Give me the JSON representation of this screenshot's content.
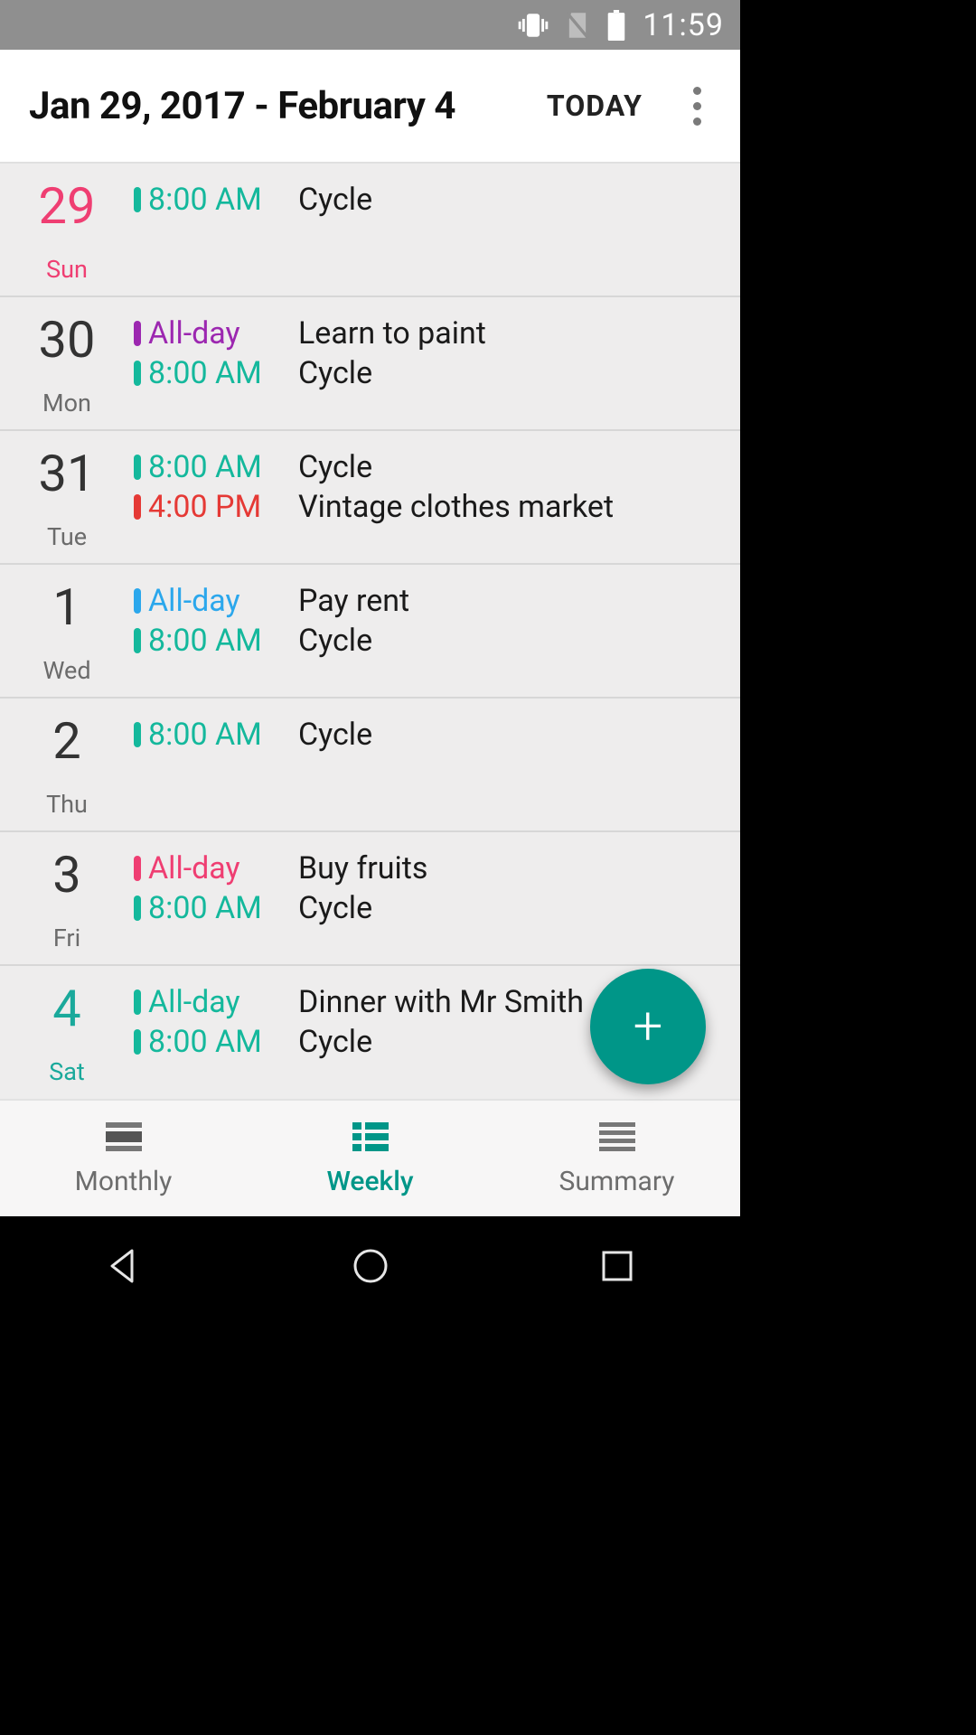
{
  "status": {
    "time": "11:59"
  },
  "header": {
    "title": "Jan 29, 2017 - February 4",
    "today_label": "TODAY"
  },
  "colors": {
    "pink": "#ef3e72",
    "teal": "#009688",
    "teal_text": "#1aa99b",
    "blue": "#2ba7ec",
    "purple": "#9c27b0",
    "red": "#e53935",
    "green": "#14b89c",
    "default": "#333333",
    "dow": "#6b6b6b"
  },
  "days": [
    {
      "num": "29",
      "dow": "Sun",
      "date_color": "pink",
      "events": [
        {
          "time": "8:00 AM",
          "title": "Cycle",
          "color": "green"
        }
      ]
    },
    {
      "num": "30",
      "dow": "Mon",
      "date_color": "default",
      "events": [
        {
          "time": "All-day",
          "title": "Learn to paint",
          "color": "purple"
        },
        {
          "time": "8:00 AM",
          "title": "Cycle",
          "color": "green"
        }
      ]
    },
    {
      "num": "31",
      "dow": "Tue",
      "date_color": "default",
      "events": [
        {
          "time": "8:00 AM",
          "title": "Cycle",
          "color": "green"
        },
        {
          "time": "4:00 PM",
          "title": "Vintage clothes market",
          "color": "red"
        }
      ]
    },
    {
      "num": "1",
      "dow": "Wed",
      "date_color": "default",
      "events": [
        {
          "time": "All-day",
          "title": "Pay rent",
          "color": "blue"
        },
        {
          "time": "8:00 AM",
          "title": "Cycle",
          "color": "green"
        }
      ]
    },
    {
      "num": "2",
      "dow": "Thu",
      "date_color": "default",
      "events": [
        {
          "time": "8:00 AM",
          "title": "Cycle",
          "color": "green"
        }
      ]
    },
    {
      "num": "3",
      "dow": "Fri",
      "date_color": "default",
      "events": [
        {
          "time": "All-day",
          "title": "Buy fruits",
          "color": "pink"
        },
        {
          "time": "8:00 AM",
          "title": "Cycle",
          "color": "green"
        }
      ]
    },
    {
      "num": "4",
      "dow": "Sat",
      "date_color": "teal_text",
      "events": [
        {
          "time": "All-day",
          "title": "Dinner with Mr Smith",
          "color": "green"
        },
        {
          "time": "8:00 AM",
          "title": "Cycle",
          "color": "green"
        }
      ]
    }
  ],
  "fab": {
    "label": "+"
  },
  "tabs": {
    "monthly": "Monthly",
    "weekly": "Weekly",
    "summary": "Summary",
    "active": "weekly"
  }
}
